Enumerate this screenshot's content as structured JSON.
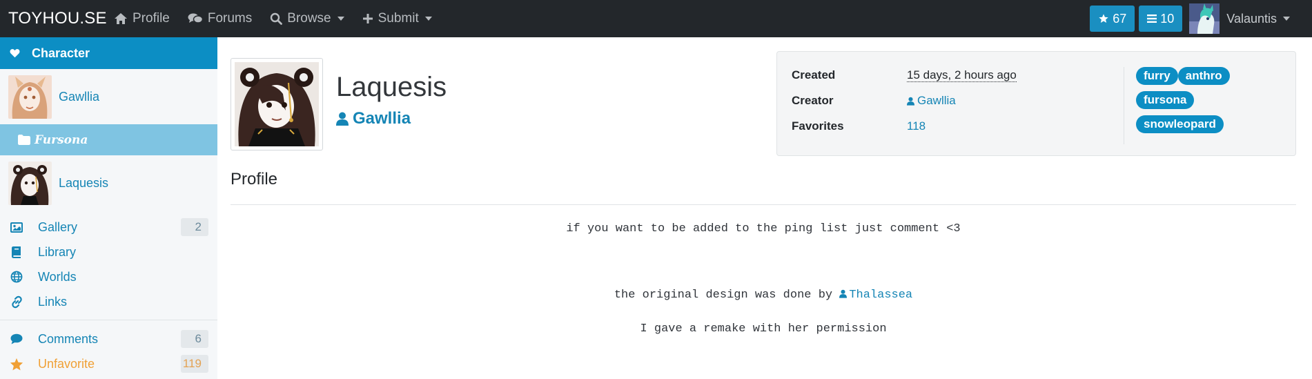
{
  "nav": {
    "brand": "TOYHOU.SE",
    "links": [
      {
        "label": "Profile",
        "icon": "home-icon"
      },
      {
        "label": "Forums",
        "icon": "comments-icon"
      },
      {
        "label": "Browse",
        "icon": "search-icon"
      },
      {
        "label": "Submit",
        "icon": "plus-icon"
      }
    ],
    "favorites_count": "67",
    "lists_count": "10",
    "username": "Valauntis"
  },
  "sidebar": {
    "header": "Character",
    "owner_character": "Gawllia",
    "folder": "Fursona",
    "current_character": "Laquesis",
    "menu": [
      {
        "label": "Gallery",
        "count": "2",
        "icon": "image-icon"
      },
      {
        "label": "Library",
        "count": "",
        "icon": "book-icon"
      },
      {
        "label": "Worlds",
        "count": "",
        "icon": "globe-icon"
      },
      {
        "label": "Links",
        "count": "",
        "icon": "link-icon"
      }
    ],
    "menu2": [
      {
        "label": "Comments",
        "count": "6",
        "icon": "comment-icon"
      },
      {
        "label": "Unfavorite",
        "count": "119",
        "icon": "star-icon"
      }
    ]
  },
  "character": {
    "name": "Laquesis",
    "owner": "Gawllia"
  },
  "info": {
    "created_label": "Created",
    "created_value": "15 days, 2 hours ago",
    "creator_label": "Creator",
    "creator_value": "Gawllia",
    "favorites_label": "Favorites",
    "favorites_value": "118",
    "tags": [
      "furry",
      "anthro",
      "fursona",
      "snowleopard"
    ]
  },
  "profile": {
    "title": "Profile",
    "line1": "if you want to be added to the ping list just comment <3",
    "line2_prefix": "the original design was done by",
    "line2_mention": "Thalassea",
    "line3": "I gave a remake with her permission"
  },
  "colors": {
    "navbar": "#23272b",
    "accent": "#0c8ec4",
    "link": "#1585b5",
    "folder": "#7fc4e2",
    "unfavorite": "#f0a035"
  }
}
